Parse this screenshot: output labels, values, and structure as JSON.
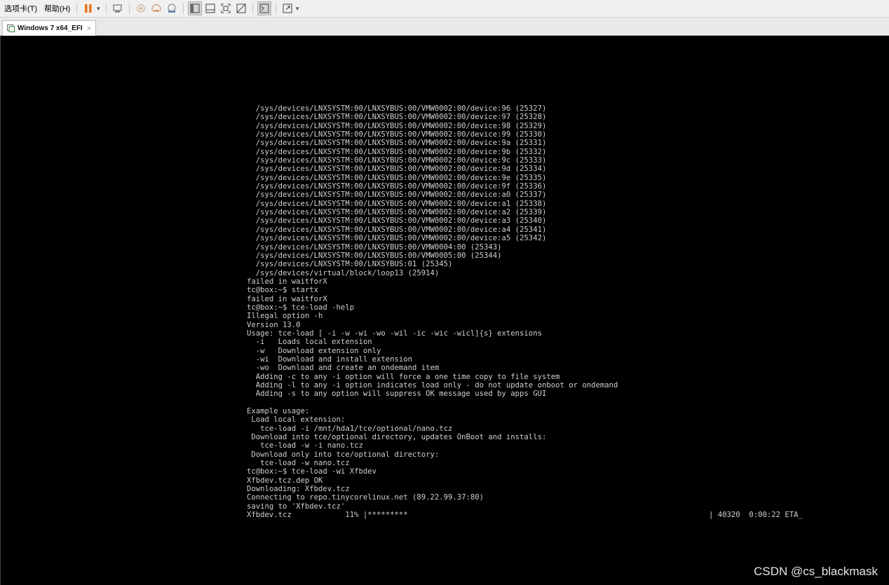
{
  "menubar": {
    "tabs_menu": "选项卡(T)",
    "help_menu": "帮助(H)"
  },
  "toolbar": {
    "icons": [
      "pause-icon",
      "send-ctrl-alt-del-icon",
      "snapshot-icon",
      "revert-snapshot-icon",
      "snapshot-manager-icon",
      "show-library-icon",
      "thumbnail-bar-icon",
      "full-screen-icon",
      "unity-icon",
      "console-view-icon",
      "stretch-guest-icon"
    ],
    "accent_color": "#e8731a"
  },
  "vm_tab": {
    "label": "Windows 7 x64_EFI",
    "close": "×"
  },
  "console": {
    "lines": [
      "  /sys/devices/LNXSYSTM:00/LNXSYBUS:00/VMW0002:00/device:96 (25327)",
      "  /sys/devices/LNXSYSTM:00/LNXSYBUS:00/VMW0002:00/device:97 (25328)",
      "  /sys/devices/LNXSYSTM:00/LNXSYBUS:00/VMW0002:00/device:98 (25329)",
      "  /sys/devices/LNXSYSTM:00/LNXSYBUS:00/VMW0002:00/device:99 (25330)",
      "  /sys/devices/LNXSYSTM:00/LNXSYBUS:00/VMW0002:00/device:9a (25331)",
      "  /sys/devices/LNXSYSTM:00/LNXSYBUS:00/VMW0002:00/device:9b (25332)",
      "  /sys/devices/LNXSYSTM:00/LNXSYBUS:00/VMW0002:00/device:9c (25333)",
      "  /sys/devices/LNXSYSTM:00/LNXSYBUS:00/VMW0002:00/device:9d (25334)",
      "  /sys/devices/LNXSYSTM:00/LNXSYBUS:00/VMW0002:00/device:9e (25335)",
      "  /sys/devices/LNXSYSTM:00/LNXSYBUS:00/VMW0002:00/device:9f (25336)",
      "  /sys/devices/LNXSYSTM:00/LNXSYBUS:00/VMW0002:00/device:a0 (25337)",
      "  /sys/devices/LNXSYSTM:00/LNXSYBUS:00/VMW0002:00/device:a1 (25338)",
      "  /sys/devices/LNXSYSTM:00/LNXSYBUS:00/VMW0002:00/device:a2 (25339)",
      "  /sys/devices/LNXSYSTM:00/LNXSYBUS:00/VMW0002:00/device:a3 (25340)",
      "  /sys/devices/LNXSYSTM:00/LNXSYBUS:00/VMW0002:00/device:a4 (25341)",
      "  /sys/devices/LNXSYSTM:00/LNXSYBUS:00/VMW0002:00/device:a5 (25342)",
      "  /sys/devices/LNXSYSTM:00/LNXSYBUS:00/VMW0004:00 (25343)",
      "  /sys/devices/LNXSYSTM:00/LNXSYBUS:00/VMW0005:00 (25344)",
      "  /sys/devices/LNXSYSTM:00/LNXSYBUS:01 (25345)",
      "  /sys/devices/virtual/block/loop13 (25914)",
      "failed in waitforX",
      "tc@box:~$ startx",
      "failed in waitforX",
      "tc@box:~$ tce-load -help",
      "Illegal option -h",
      "Version 13.0",
      "Usage: tce-load [ -i -w -wi -wo -wil -ic -wic -wicl]{s} extensions",
      "  -i   Loads local extension",
      "  -w   Download extension only",
      "  -wi  Download and install extension",
      "  -wo  Download and create an ondemand item",
      "  Adding -c to any -i option will force a one time copy to file system",
      "  Adding -l to any -i option indicates load only - do not update onboot or ondemand",
      "  Adding -s to any option will suppress OK message used by apps GUI",
      "",
      "Example usage:",
      " Load local extension:",
      "   tce-load -i /mnt/hda1/tce/optional/nano.tcz",
      " Download into tce/optional directory, updates OnBoot and installs:",
      "   tce-load -w -i nano.tcz",
      " Download only into tce/optional directory:",
      "   tce-load -w nano.tcz",
      "tc@box:~$ tce-load -wi Xfbdev",
      "Xfbdev.tcz.dep OK",
      "Downloading: Xfbdev.tcz",
      "Connecting to repo.tinycorelinux.net (89.22.99.37:80)",
      "saving to 'Xfbdev.tcz'",
      "Xfbdev.tcz            11% |*********"
    ],
    "progress_tail": "| 40320  0:00:22 ETA_"
  },
  "watermark": "CSDN @cs_blackmask"
}
